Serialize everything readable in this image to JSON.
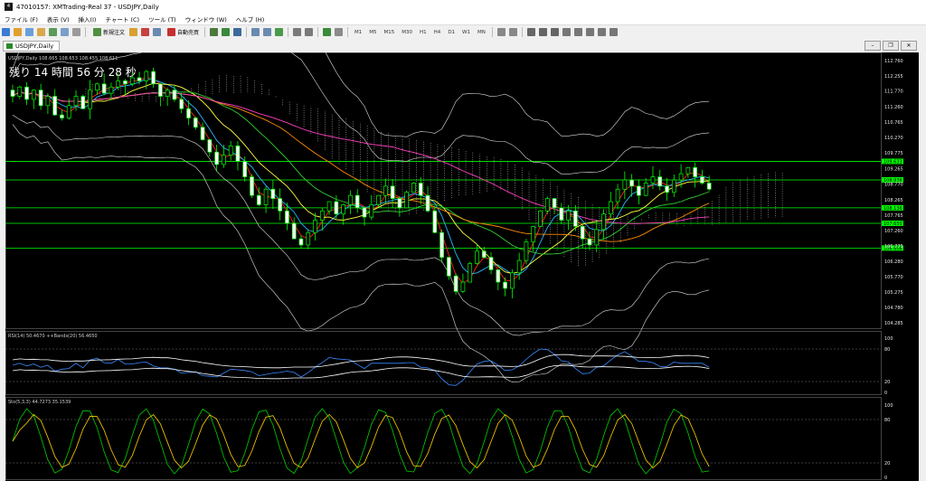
{
  "window": {
    "title": "47010157: XMTrading-Real 37 - USDJPY,Daily",
    "app_icon": "mt4-icon"
  },
  "menu": [
    "ファイル (F)",
    "表示 (V)",
    "挿入(I)",
    "チャート (C)",
    "ツール (T)",
    "ウィンドウ (W)",
    "ヘルプ (H)"
  ],
  "toolbar": {
    "new_order": "新規注文",
    "auto_trade": "自動売買",
    "timeframes": [
      "M1",
      "M5",
      "M15",
      "M30",
      "H1",
      "H4",
      "D1",
      "W1",
      "MN"
    ]
  },
  "chart_tab": {
    "label": "USDJPY,Daily"
  },
  "chart": {
    "header": "USDJPY,Daily  108.665 108.653 108.455 108.611",
    "countdown": "残り 14 時間 56 分 28 秒",
    "price_labels": [
      "112.760",
      "112.255",
      "111.770",
      "111.260",
      "110.765",
      "110.270",
      "109.775",
      "109.265",
      "108.770",
      "108.265",
      "107.765",
      "107.260",
      "106.775",
      "106.280",
      "105.770",
      "105.275",
      "104.780",
      "104.285"
    ],
    "price_values": [
      112.76,
      112.255,
      111.77,
      111.26,
      110.765,
      110.27,
      109.775,
      109.265,
      108.77,
      108.265,
      107.765,
      107.26,
      106.775,
      106.28,
      105.77,
      105.275,
      104.78,
      104.285
    ],
    "ylim": [
      104.2,
      112.9
    ],
    "h_lines": [
      {
        "price": 109.5,
        "label": "109.633",
        "color": "#00ff00"
      },
      {
        "price": 108.9,
        "label": "108.936",
        "color": "#00ff00"
      },
      {
        "price": 108.0,
        "label": "108.136",
        "color": "#00ff00"
      },
      {
        "price": 107.5,
        "label": "107.650",
        "color": "#00ff00"
      },
      {
        "price": 106.7,
        "label": "106.606",
        "color": "#00ff00"
      }
    ],
    "current_price_label": "108.611"
  },
  "chart_data": {
    "type": "line",
    "closes": [
      111.6,
      111.9,
      111.5,
      111.8,
      111.3,
      111.6,
      111.0,
      110.9,
      111.3,
      111.6,
      111.2,
      111.8,
      112.0,
      111.7,
      111.9,
      112.1,
      112.0,
      112.2,
      112.1,
      112.4,
      112.0,
      111.6,
      111.8,
      111.5,
      111.2,
      110.9,
      110.6,
      110.2,
      109.8,
      109.4,
      109.7,
      110.0,
      109.5,
      109.0,
      108.4,
      108.1,
      108.6,
      108.3,
      107.9,
      107.5,
      107.0,
      106.8,
      107.2,
      107.6,
      107.9,
      108.2,
      107.8,
      108.1,
      108.4,
      108.0,
      107.7,
      108.1,
      108.4,
      108.7,
      108.3,
      108.0,
      108.5,
      108.8,
      108.4,
      107.9,
      107.2,
      106.4,
      105.8,
      105.3,
      105.6,
      106.2,
      106.6,
      106.4,
      106.0,
      105.6,
      105.4,
      105.9,
      106.3,
      106.9,
      107.4,
      107.9,
      108.3,
      108.0,
      107.6,
      107.9,
      107.4,
      107.0,
      106.8,
      107.3,
      107.8,
      108.2,
      108.6,
      108.9,
      108.7,
      108.4,
      108.8,
      109.0,
      108.7,
      108.5,
      108.9,
      109.1,
      109.3,
      109.0,
      108.8,
      108.6
    ],
    "rsi": {
      "label": "RSI(14) 50.4670  ++Bands(20) 56.4650",
      "ylim": [
        0,
        100
      ],
      "levels": [
        80,
        20
      ],
      "axis_labels": [
        "100",
        "80",
        "20",
        "0"
      ]
    },
    "stoch": {
      "label": "Sto(5,3,3) 44.7273 35.1539",
      "ylim": [
        0,
        100
      ],
      "levels": [
        80,
        20
      ],
      "axis_labels": [
        "100",
        "80",
        "20",
        "0"
      ]
    }
  }
}
